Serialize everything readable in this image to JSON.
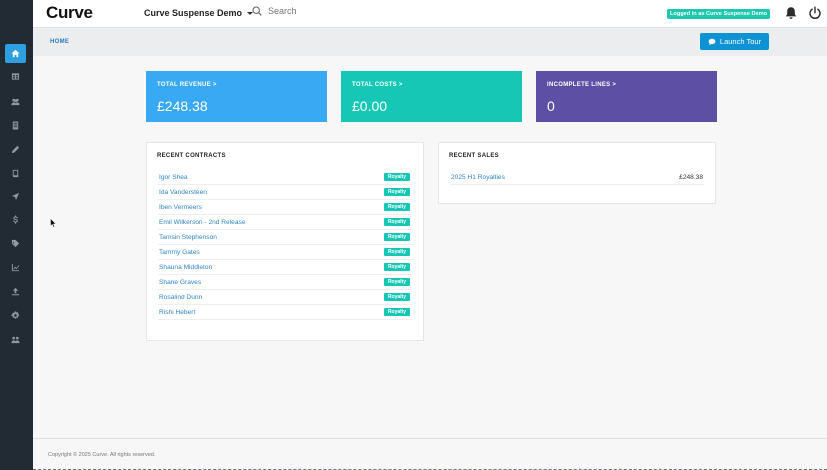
{
  "topbar": {
    "logo": "Curve",
    "company": "Curve Suspense Demo",
    "search_placeholder": "Search",
    "logged_in": "Logged in as Curve Suspense Demo"
  },
  "breadcrumb": "HOME",
  "tour_button": "Launch Tour",
  "stats": [
    {
      "label": "TOTAL REVENUE >",
      "value": "£248.38",
      "color": "#3aa9f3"
    },
    {
      "label": "TOTAL COSTS >",
      "value": "£0.00",
      "color": "#17c7b6"
    },
    {
      "label": "INCOMPLETE LINES >",
      "value": "0",
      "color": "#5d4fa3"
    }
  ],
  "recent_contracts": {
    "title": "RECENT CONTRACTS",
    "rows": [
      {
        "name": "Igor Shea",
        "tag": "Royalty"
      },
      {
        "name": "Ida Vandersteen",
        "tag": "Royalty"
      },
      {
        "name": "Iben Vermeers",
        "tag": "Royalty"
      },
      {
        "name": "Emil Wilkerson - 2nd Release",
        "tag": "Royalty"
      },
      {
        "name": "Tamsin Stephenson",
        "tag": "Royalty"
      },
      {
        "name": "Tammy Gates",
        "tag": "Royalty"
      },
      {
        "name": "Shauna Middleton",
        "tag": "Royalty"
      },
      {
        "name": "Shane Graves",
        "tag": "Royalty"
      },
      {
        "name": "Rosalind Dunn",
        "tag": "Royalty"
      },
      {
        "name": "Rishi Hebert",
        "tag": "Royalty"
      }
    ]
  },
  "recent_sales": {
    "title": "RECENT SALES",
    "rows": [
      {
        "name": "2025 H1 Royalties",
        "amount": "£248.38"
      }
    ]
  },
  "sidebar_icons": [
    "home-icon",
    "table-icon",
    "users-icon",
    "document-icon",
    "pencil-icon",
    "book-icon",
    "send-icon",
    "dollar-icon",
    "tag-icon",
    "chart-icon",
    "upload-icon",
    "gear-icon",
    "group-icon"
  ],
  "footer": "Copyright © 2025 Curve. All rights reserved."
}
